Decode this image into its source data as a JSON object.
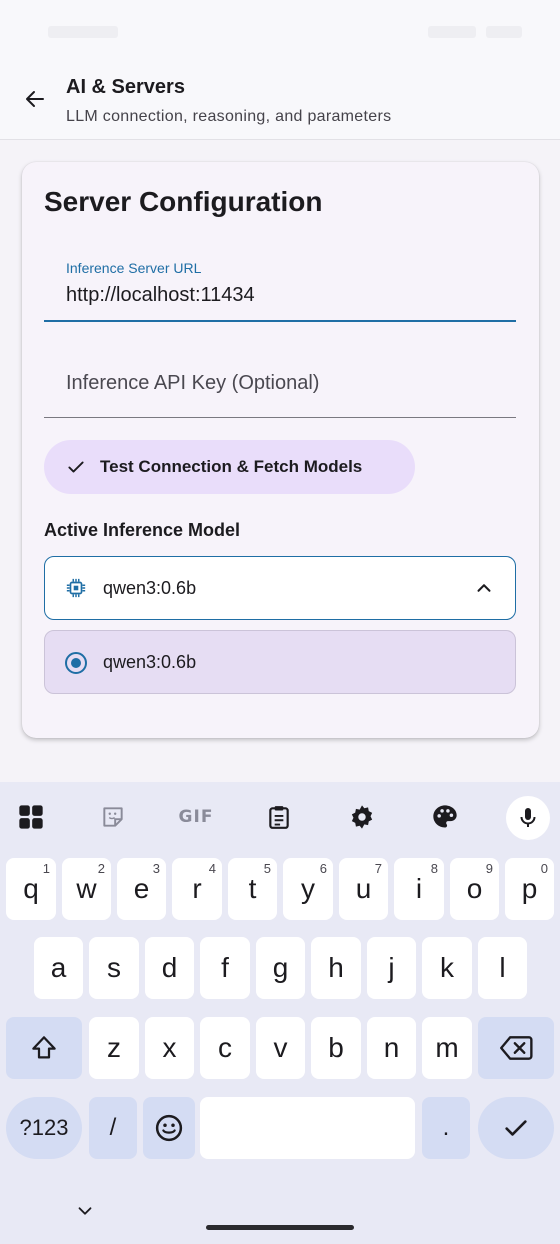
{
  "header": {
    "back_icon": "arrow-left-icon",
    "title": "AI & Servers",
    "subtitle": "LLM connection, reasoning, and parameters"
  },
  "card": {
    "title": "Server Configuration",
    "url_field": {
      "label": "Inference Server URL",
      "value": "http://localhost:11434"
    },
    "api_key_field": {
      "placeholder": "Inference API Key (Optional)",
      "value": ""
    },
    "test_button": {
      "icon": "check-icon",
      "label": "Test Connection & Fetch Models"
    },
    "model_section_label": "Active Inference Model",
    "model_dropdown": {
      "icon": "chip-icon",
      "selected": "qwen3:0.6b",
      "expanded": true
    },
    "model_options": [
      {
        "label": "qwen3:0.6b",
        "selected": true
      }
    ]
  },
  "keyboard": {
    "toolbar": [
      "apps-grid-icon",
      "sticker-icon",
      "gif-icon",
      "clipboard-icon",
      "settings-gear-icon",
      "palette-icon",
      "mic-icon"
    ],
    "gif_label": "GIF",
    "row1": [
      {
        "key": "q",
        "num": "1"
      },
      {
        "key": "w",
        "num": "2"
      },
      {
        "key": "e",
        "num": "3"
      },
      {
        "key": "r",
        "num": "4"
      },
      {
        "key": "t",
        "num": "5"
      },
      {
        "key": "y",
        "num": "6"
      },
      {
        "key": "u",
        "num": "7"
      },
      {
        "key": "i",
        "num": "8"
      },
      {
        "key": "o",
        "num": "9"
      },
      {
        "key": "p",
        "num": "0"
      }
    ],
    "row2": [
      "a",
      "s",
      "d",
      "f",
      "g",
      "h",
      "j",
      "k",
      "l"
    ],
    "row3": [
      "z",
      "x",
      "c",
      "v",
      "b",
      "n",
      "m"
    ],
    "row4": {
      "symbols": "?123",
      "slash": "/",
      "period": "."
    }
  },
  "colors": {
    "accent": "#1f6ea5",
    "button_tonal": "#e9ddfa",
    "selected_option": "#e6ddf3",
    "keyboard_bg": "#e8e9f5",
    "function_key": "#d4dcf3"
  }
}
